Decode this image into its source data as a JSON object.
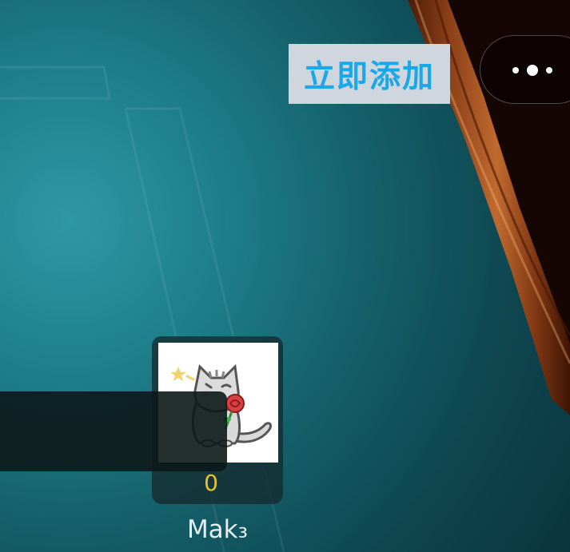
{
  "header": {
    "add_button_label": "立即添加",
    "more_icon": "more-dots-icon"
  },
  "player": {
    "avatar_icon": "cat-holding-rose-avatar",
    "score": "0",
    "name": "Mak₃"
  },
  "colors": {
    "felt": "#1d7c88",
    "wood_rail": "#8a3f17",
    "add_button_bg": "#cfd6dd",
    "add_button_text": "#1ba8e8",
    "score_text": "#e8c12e"
  }
}
